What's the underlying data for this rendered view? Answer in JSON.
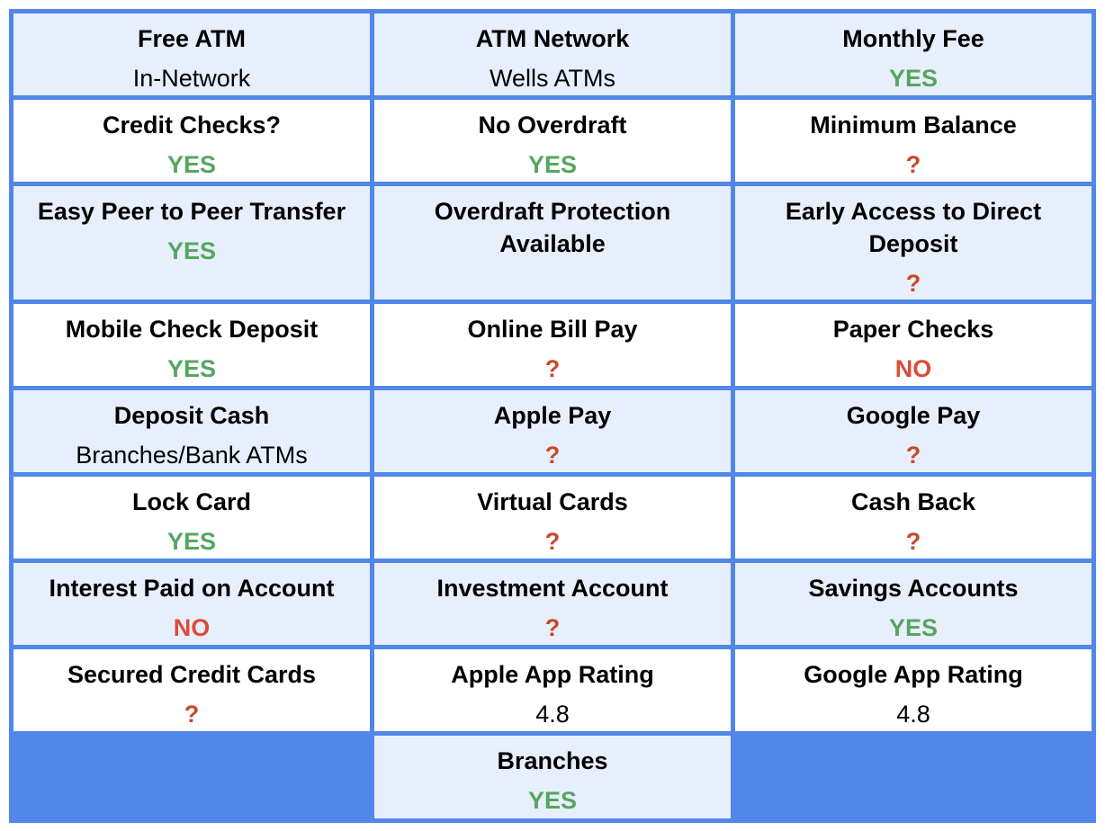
{
  "colors": {
    "border": "#5087e8",
    "tint_row": "#e8effc",
    "yes": "#55a660",
    "no": "#dd4b39",
    "unknown": "#c9482a"
  },
  "features": [
    {
      "label": "Free ATM",
      "value": "In-Network",
      "status": "text"
    },
    {
      "label": "ATM Network",
      "value": "Wells ATMs",
      "status": "text"
    },
    {
      "label": "Monthly Fee",
      "value": "YES",
      "status": "yes"
    },
    {
      "label": "Credit Checks?",
      "value": "YES",
      "status": "yes"
    },
    {
      "label": "No Overdraft",
      "value": "YES",
      "status": "yes"
    },
    {
      "label": "Minimum Balance",
      "value": "?",
      "status": "unknown"
    },
    {
      "label": "Easy Peer to Peer Transfer",
      "value": "YES",
      "status": "yes"
    },
    {
      "label": "Overdraft Protection Available",
      "value": "",
      "status": "empty"
    },
    {
      "label": "Early Access to Direct Deposit",
      "value": "?",
      "status": "unknown"
    },
    {
      "label": "Mobile Check Deposit",
      "value": "YES",
      "status": "yes"
    },
    {
      "label": "Online Bill Pay",
      "value": "?",
      "status": "unknown"
    },
    {
      "label": "Paper Checks",
      "value": "NO",
      "status": "no"
    },
    {
      "label": "Deposit Cash",
      "value": "Branches/Bank ATMs",
      "status": "text"
    },
    {
      "label": "Apple Pay",
      "value": "?",
      "status": "unknown"
    },
    {
      "label": "Google Pay",
      "value": "?",
      "status": "unknown"
    },
    {
      "label": "Lock Card",
      "value": "YES",
      "status": "yes"
    },
    {
      "label": "Virtual Cards",
      "value": "?",
      "status": "unknown"
    },
    {
      "label": "Cash Back",
      "value": "?",
      "status": "unknown"
    },
    {
      "label": "Interest Paid on Account",
      "value": "NO",
      "status": "no"
    },
    {
      "label": "Investment Account",
      "value": "?",
      "status": "unknown"
    },
    {
      "label": "Savings Accounts",
      "value": "YES",
      "status": "yes"
    },
    {
      "label": "Secured Credit Cards",
      "value": "?",
      "status": "unknown"
    },
    {
      "label": "Apple App Rating",
      "value": "4.8",
      "status": "text"
    },
    {
      "label": "Google App Rating",
      "value": "4.8",
      "status": "text"
    },
    {
      "label": "Branches",
      "value": "YES",
      "status": "yes"
    }
  ]
}
